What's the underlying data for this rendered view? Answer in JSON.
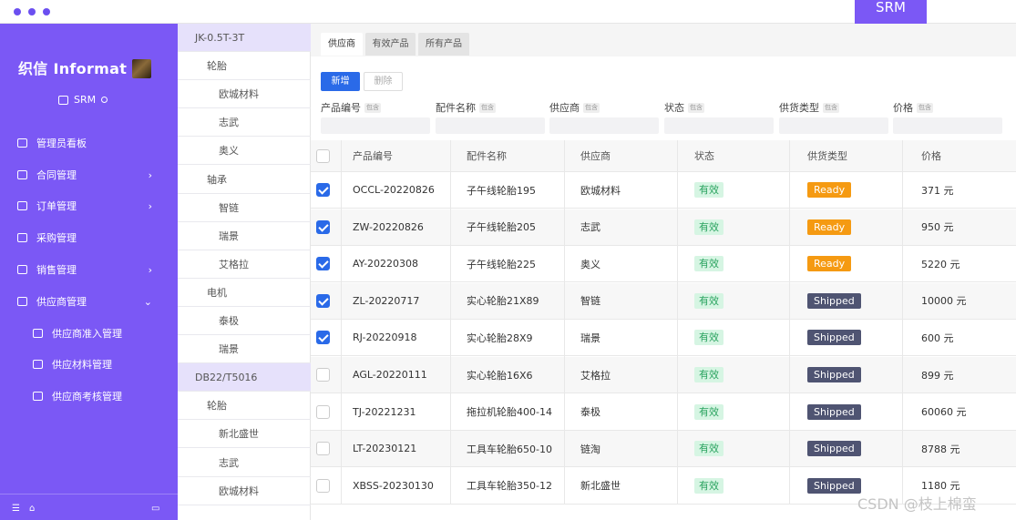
{
  "window": {
    "app_tab": "SRM"
  },
  "nav": {
    "logo": "织信 Informat",
    "module": "SRM",
    "items": [
      {
        "label": "管理员看板",
        "icon": "user-icon",
        "arrow": ""
      },
      {
        "label": "合同管理",
        "icon": "document-icon",
        "arrow": "›"
      },
      {
        "label": "订单管理",
        "icon": "table-icon",
        "arrow": "›"
      },
      {
        "label": "采购管理",
        "icon": "table-icon",
        "arrow": ""
      },
      {
        "label": "销售管理",
        "icon": "table-icon",
        "arrow": "›"
      },
      {
        "label": "供应商管理",
        "icon": "table-icon",
        "arrow": "⌄"
      }
    ],
    "subitems": [
      {
        "label": "供应商准入管理",
        "icon": "table-icon"
      },
      {
        "label": "供应材料管理",
        "icon": "table-icon"
      },
      {
        "label": "供应商考核管理",
        "icon": "table-icon"
      }
    ]
  },
  "categories": [
    {
      "label": "JK-0.5T-3T",
      "level": 1
    },
    {
      "label": "轮胎",
      "level": 2
    },
    {
      "label": "欧城材料",
      "level": 3
    },
    {
      "label": "志武",
      "level": 3
    },
    {
      "label": "奥义",
      "level": 3
    },
    {
      "label": "轴承",
      "level": 2
    },
    {
      "label": "智链",
      "level": 3
    },
    {
      "label": "瑞景",
      "level": 3
    },
    {
      "label": "艾格拉",
      "level": 3
    },
    {
      "label": "电机",
      "level": 2
    },
    {
      "label": "泰极",
      "level": 3
    },
    {
      "label": "瑞景",
      "level": 3
    },
    {
      "label": "DB22/T5016",
      "level": 1
    },
    {
      "label": "轮胎",
      "level": 2
    },
    {
      "label": "新北盛世",
      "level": 3
    },
    {
      "label": "志武",
      "level": 3
    },
    {
      "label": "欧城材料",
      "level": 3
    }
  ],
  "tabs": [
    {
      "label": "供应商",
      "active": true
    },
    {
      "label": "有效产品",
      "active": false
    },
    {
      "label": "所有产品",
      "active": false
    }
  ],
  "toolbar": {
    "add": "新增",
    "delete": "删除"
  },
  "filters": [
    {
      "label": "产品编号",
      "tag": "包含"
    },
    {
      "label": "配件名称",
      "tag": "包含"
    },
    {
      "label": "供应商",
      "tag": "包含"
    },
    {
      "label": "状态",
      "tag": "包含"
    },
    {
      "label": "供货类型",
      "tag": "包含"
    },
    {
      "label": "价格",
      "tag": "包含"
    }
  ],
  "table": {
    "headers": [
      "产品编号",
      "配件名称",
      "供应商",
      "状态",
      "供货类型",
      "价格"
    ],
    "rows": [
      {
        "checked": true,
        "code": "OCCL-20220826",
        "name": "子午线轮胎195",
        "supplier": "欧城材料",
        "status": "有效",
        "type": "Ready",
        "price": "371 元"
      },
      {
        "checked": true,
        "code": "ZW-20220826",
        "name": "子午线轮胎205",
        "supplier": "志武",
        "status": "有效",
        "type": "Ready",
        "price": "950 元"
      },
      {
        "checked": true,
        "code": "AY-20220308",
        "name": "子午线轮胎225",
        "supplier": "奥义",
        "status": "有效",
        "type": "Ready",
        "price": "5220 元"
      },
      {
        "checked": true,
        "code": "ZL-20220717",
        "name": "实心轮胎21X89",
        "supplier": "智链",
        "status": "有效",
        "type": "Shipped",
        "price": "10000 元"
      },
      {
        "checked": true,
        "code": "RJ-20220918",
        "name": "实心轮胎28X9",
        "supplier": "瑞景",
        "status": "有效",
        "type": "Shipped",
        "price": "600 元"
      },
      {
        "checked": false,
        "code": "AGL-20220111",
        "name": "实心轮胎16X6",
        "supplier": "艾格拉",
        "status": "有效",
        "type": "Shipped",
        "price": "899 元"
      },
      {
        "checked": false,
        "code": "TJ-20221231",
        "name": "拖拉机轮胎400-14",
        "supplier": "泰极",
        "status": "有效",
        "type": "Shipped",
        "price": "60060 元"
      },
      {
        "checked": false,
        "code": "LT-20230121",
        "name": "工具车轮胎650-10",
        "supplier": "链淘",
        "status": "有效",
        "type": "Shipped",
        "price": "8788 元"
      },
      {
        "checked": false,
        "code": "XBSS-20230130",
        "name": "工具车轮胎350-12",
        "supplier": "新北盛世",
        "status": "有效",
        "type": "Shipped",
        "price": "1180 元"
      }
    ]
  },
  "watermark": "CSDN @枝上棉蛮",
  "colors": {
    "brand": "#7b58f5",
    "primary": "#2a6ae8",
    "ready": "#f59a12",
    "shipped": "#4f5472",
    "valid": "#2aa35f"
  }
}
